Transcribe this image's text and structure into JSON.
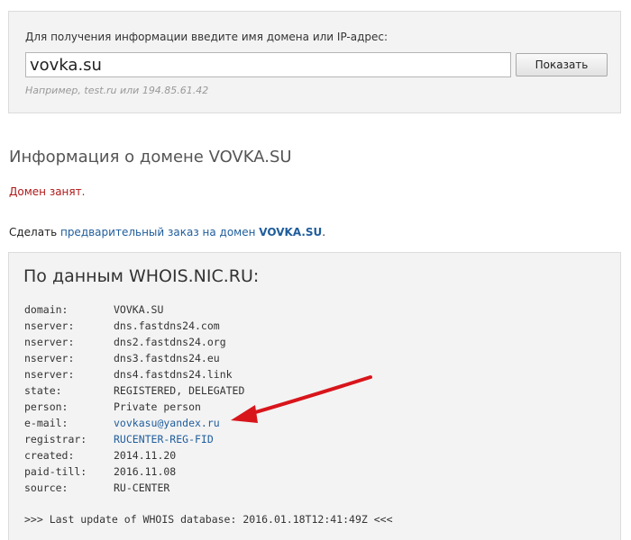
{
  "search": {
    "caption": "Для получения информации введите имя домена или IP-адрес:",
    "value": "vovka.su",
    "button_label": "Показать",
    "hint": "Например, test.ru или 194.85.61.42"
  },
  "result": {
    "heading": "Информация о домене VOVKA.SU",
    "status": "Домен занят.",
    "preorder_prefix": "Сделать ",
    "preorder_link": "предварительный заказ на домен",
    "preorder_domain": "VOVKA.SU",
    "preorder_suffix": "."
  },
  "whois": {
    "title": "По данным WHOIS.NIC.RU:",
    "rows": [
      {
        "key": "domain:",
        "value": "VOVKA.SU"
      },
      {
        "key": "nserver:",
        "value": "dns.fastdns24.com"
      },
      {
        "key": "nserver:",
        "value": "dns2.fastdns24.org"
      },
      {
        "key": "nserver:",
        "value": "dns3.fastdns24.eu"
      },
      {
        "key": "nserver:",
        "value": "dns4.fastdns24.link"
      },
      {
        "key": "state:",
        "value": "REGISTERED, DELEGATED"
      },
      {
        "key": "person:",
        "value": "Private person"
      },
      {
        "key": "e-mail:",
        "value": "vovkasu@yandex.ru"
      },
      {
        "key": "registrar:",
        "value": "RUCENTER-REG-FID"
      },
      {
        "key": "created:",
        "value": "2014.11.20"
      },
      {
        "key": "paid-till:",
        "value": "2016.11.08"
      },
      {
        "key": "source:",
        "value": "RU-CENTER"
      }
    ],
    "last_update": ">>> Last update of WHOIS database: 2016.01.18T12:41:49Z <<<"
  },
  "colors": {
    "link": "#1f5d9c",
    "status_busy": "#b01818",
    "arrow": "#d8151b",
    "panel_bg": "#f3f3f3"
  },
  "icons": {
    "annotation": "red-arrow-icon"
  }
}
